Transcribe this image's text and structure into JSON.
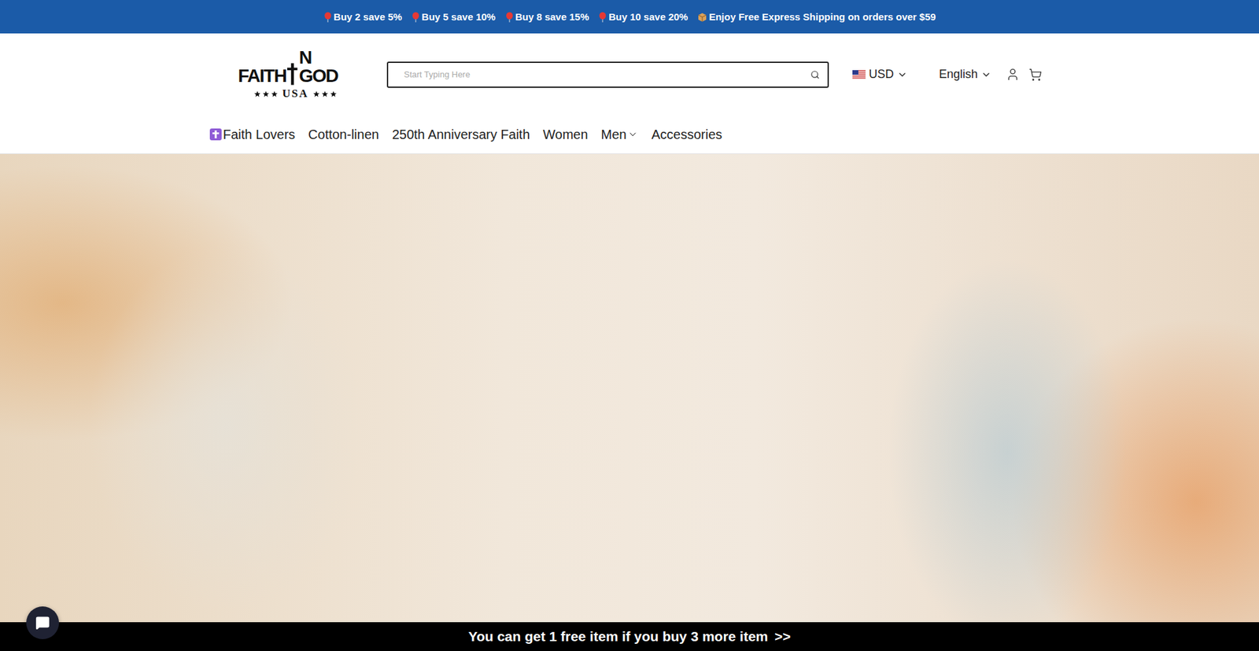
{
  "promo_bar": {
    "items": [
      {
        "text": "Buy 2 save 5%",
        "kind": "balloon"
      },
      {
        "text": "Buy 5 save 10%",
        "kind": "balloon"
      },
      {
        "text": "Buy 8 save 15%",
        "kind": "balloon"
      },
      {
        "text": "Buy 10 save 20%",
        "kind": "balloon"
      },
      {
        "text": "Enjoy Free Express Shipping on orders over $59",
        "kind": "box"
      }
    ]
  },
  "logo": {
    "left": "FAITH",
    "right": "N GOD",
    "sub": "USA"
  },
  "search": {
    "placeholder": "Start Typing Here"
  },
  "currency": {
    "label": "USD"
  },
  "language": {
    "label": "English"
  },
  "nav": {
    "items": [
      {
        "label": "Faith Lovers",
        "kind": "icon"
      },
      {
        "label": "Cotton-linen",
        "kind": "plain"
      },
      {
        "label": "250th Anniversary Faith",
        "kind": "plain"
      },
      {
        "label": "Women",
        "kind": "plain"
      },
      {
        "label": "Men",
        "kind": "menu"
      },
      {
        "label": "Accessories",
        "kind": "plain"
      }
    ]
  },
  "bottom_bar": {
    "text": "You can get 1 free item if you buy 3 more item",
    "arrow": ">>"
  }
}
